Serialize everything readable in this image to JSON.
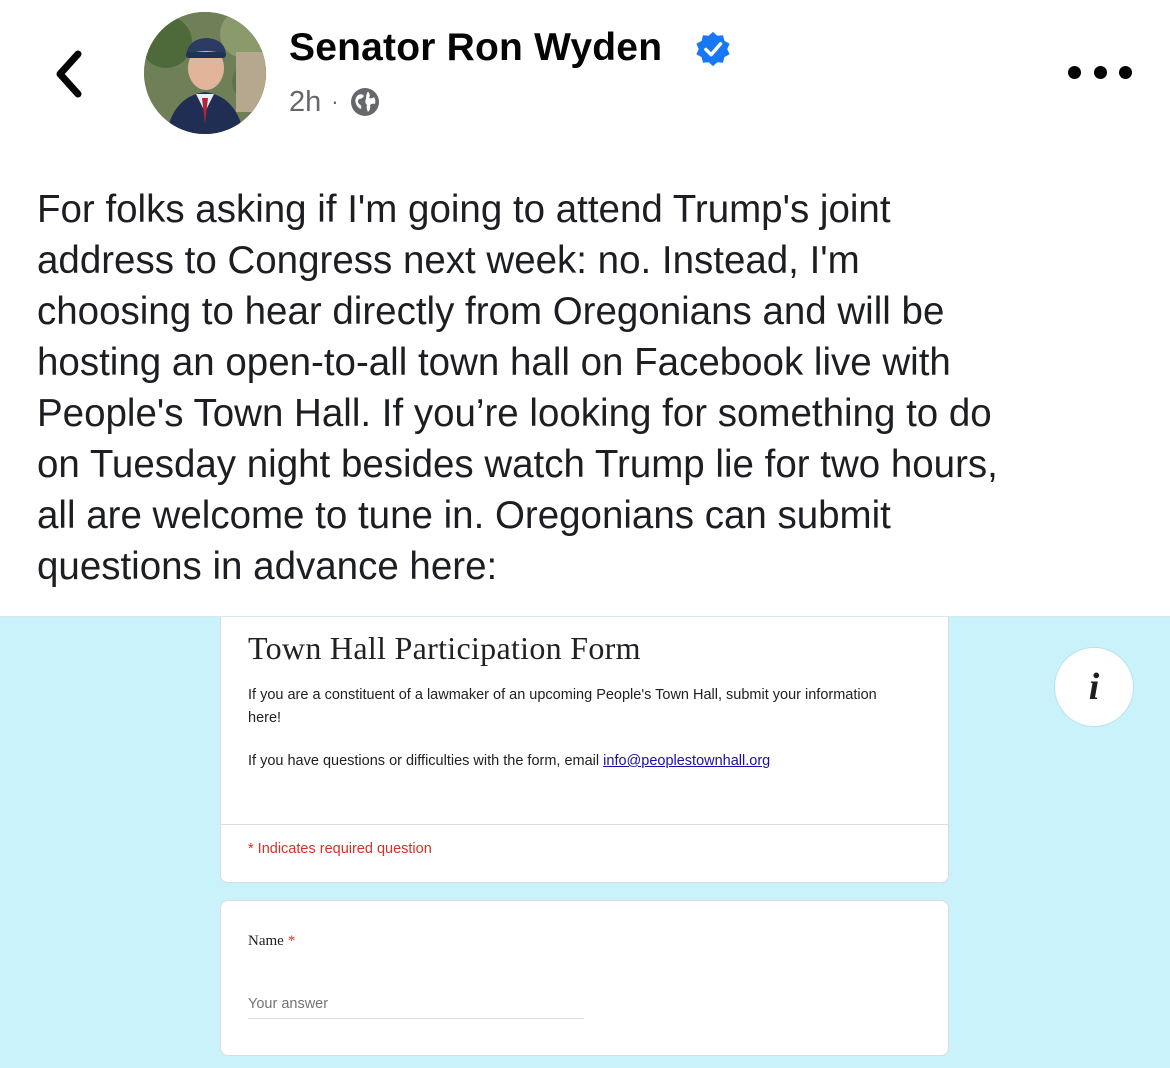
{
  "post": {
    "author": "Senator Ron Wyden",
    "time": "2h",
    "separator": "·",
    "audience_icon": "globe-icon",
    "verified_icon": "verified-badge-icon",
    "text": "For folks asking if I'm going to attend Trump's joint\naddress to Congress next week: no. Instead, I'm\nchoosing to hear directly from Oregonians and will be\nhosting an open-to-all town hall on Facebook live with\nPeople's Town Hall. If you’re looking for something to do\non Tuesday night besides watch Trump lie for two hours,\nall are welcome to tune in. Oregonians can submit\nquestions in advance here:"
  },
  "attachment": {
    "form_title": "Town Hall Participation Form",
    "description": "If you are a constituent of a lawmaker of an upcoming People's Town Hall, submit your information here!",
    "contact_prefix": "If you have questions or difficulties with the form, email ",
    "contact_email": "info@peoplestownhall.org",
    "required_note": "* Indicates required question",
    "name_label": "Name",
    "required_mark": "*",
    "name_placeholder": "Your answer",
    "info_glyph": "i"
  },
  "colors": {
    "attachment_background": "#c9f2fb",
    "verified_blue": "#1877f2",
    "required_red": "#d93025",
    "link_blue": "#1a0dab"
  }
}
